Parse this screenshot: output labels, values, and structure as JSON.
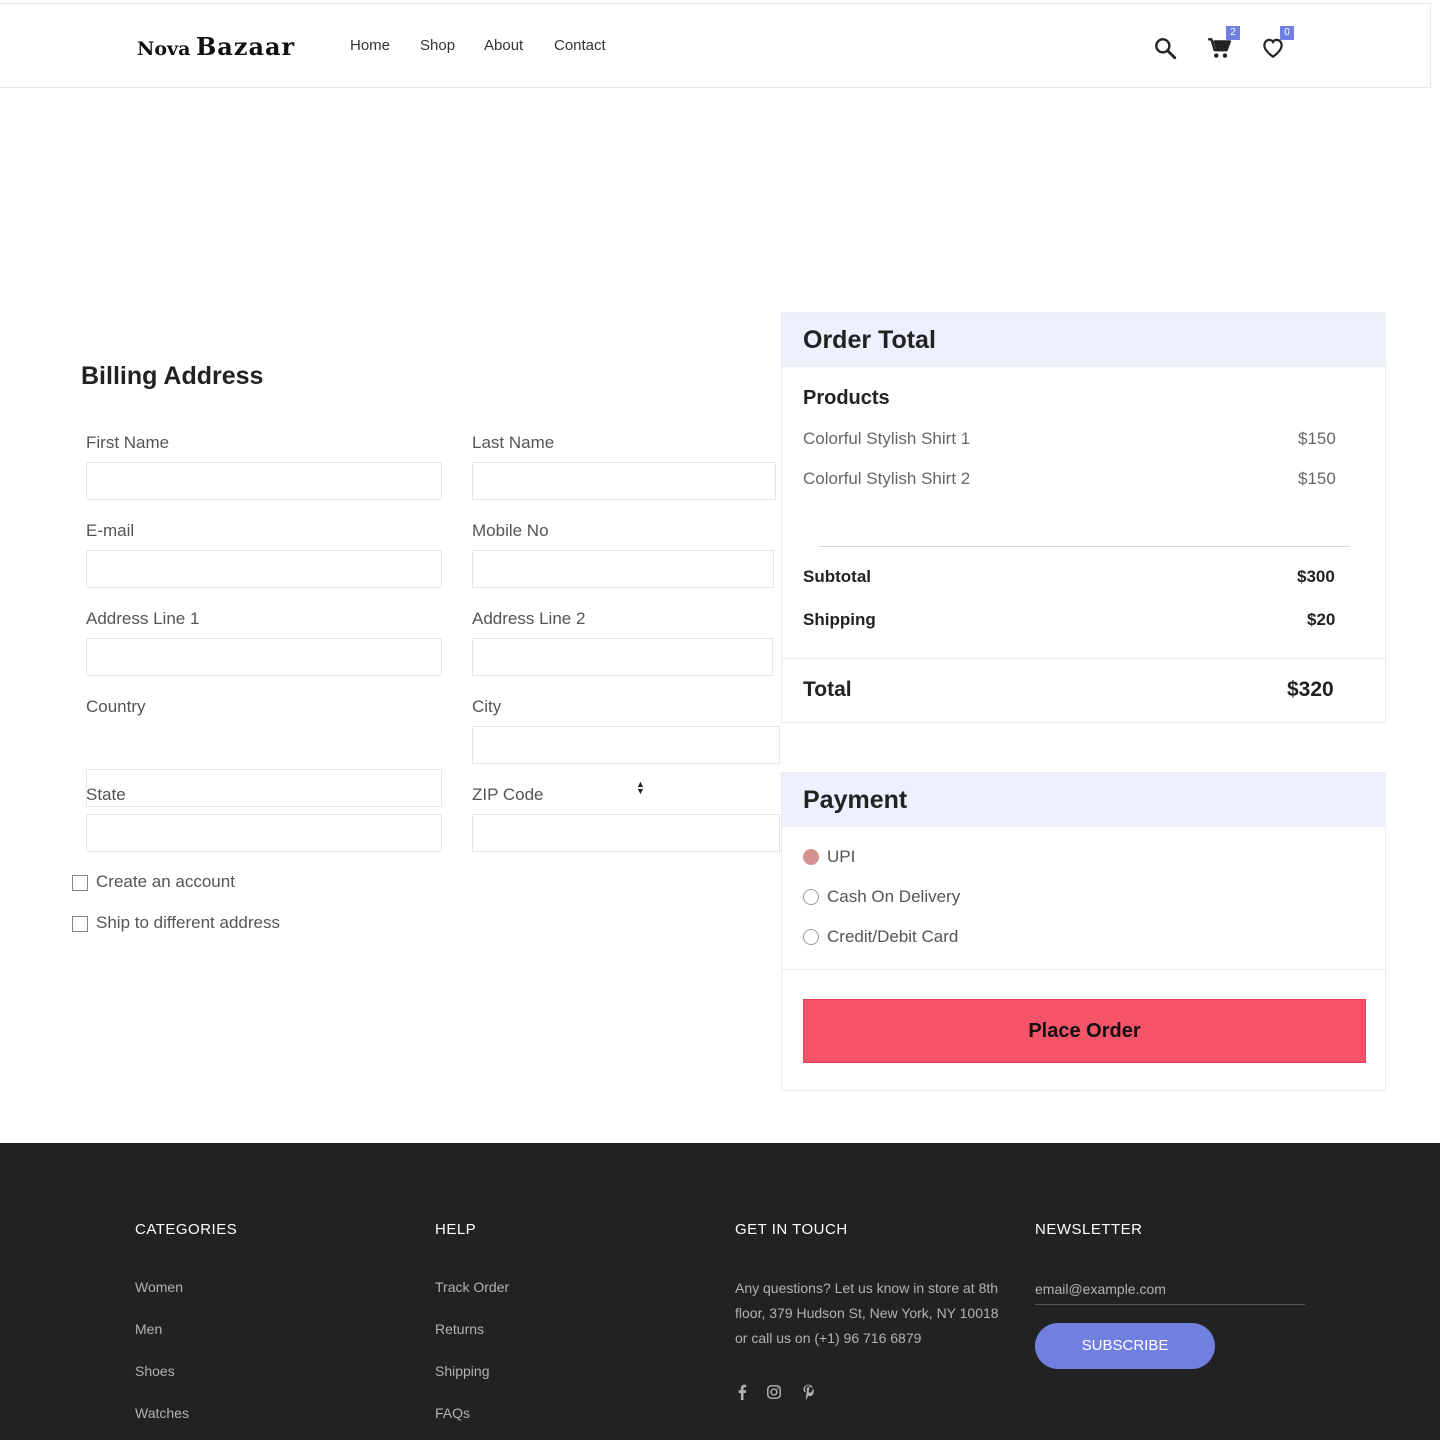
{
  "header": {
    "logo_part1": "Nova",
    "logo_part2": "Bazaar",
    "nav": [
      "Home",
      "Shop",
      "About",
      "Contact"
    ],
    "cart_count": "2",
    "wishlist_count": "0",
    "icons": [
      "search-icon",
      "cart-icon",
      "heart-icon"
    ]
  },
  "billing": {
    "title": "Billing Address",
    "fields": {
      "first_name": "First Name",
      "last_name": "Last Name",
      "email": "E-mail",
      "mobile": "Mobile No",
      "address1": "Address Line 1",
      "address2": "Address Line 2",
      "country": "Country",
      "city": "City",
      "state": "State",
      "zip": "ZIP Code"
    },
    "checkboxes": [
      "Create an account",
      "Ship to different address"
    ]
  },
  "order": {
    "title": "Order Total",
    "products_label": "Products",
    "products": [
      {
        "name": "Colorful Stylish Shirt 1",
        "price": "$150"
      },
      {
        "name": "Colorful Stylish Shirt 2",
        "price": "$150"
      }
    ],
    "subtotal_label": "Subtotal",
    "subtotal": "$300",
    "shipping_label": "Shipping",
    "shipping": "$20",
    "total_label": "Total",
    "total": "$320"
  },
  "payment": {
    "title": "Payment",
    "options": [
      "UPI",
      "Cash On Delivery",
      "Credit/Debit Card"
    ],
    "selected": "UPI",
    "place_order": "Place Order"
  },
  "footer": {
    "categories_title": "CATEGORIES",
    "categories": [
      "Women",
      "Men",
      "Shoes",
      "Watches"
    ],
    "help_title": "HELP",
    "help": [
      "Track Order",
      "Returns",
      "Shipping",
      "FAQs"
    ],
    "contact_title": "GET IN TOUCH",
    "contact_text": "Any questions? Let us know in store at 8th floor, 379 Hudson St, New York, NY 10018 or call us on (+1) 96 716 6879",
    "social": [
      "facebook-icon",
      "instagram-icon",
      "pinterest-icon"
    ],
    "newsletter_title": "NEWSLETTER",
    "email_placeholder": "email@example.com",
    "subscribe": "SUBSCRIBE"
  },
  "colors": {
    "accent": "#717fe0",
    "place_order": "#f55367",
    "panel_header": "#edf0fd",
    "footer_bg": "#222222",
    "radio_selected": "#d4918f"
  }
}
